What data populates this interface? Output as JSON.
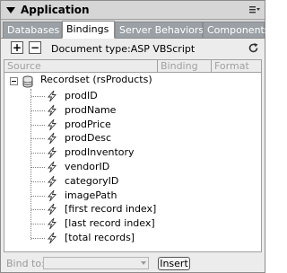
{
  "panel": {
    "title": "Application",
    "options_icon": "options-menu-icon"
  },
  "tabs": [
    {
      "label": "Databases",
      "active": false
    },
    {
      "label": "Bindings",
      "active": true
    },
    {
      "label": "Server Behaviors",
      "active": false
    },
    {
      "label": "Components",
      "active": false
    }
  ],
  "toolbar": {
    "add_label": "+",
    "remove_label": "−",
    "document_type": "Document type:ASP VBScript",
    "refresh_icon": "refresh-icon"
  },
  "columns": [
    "Source",
    "Binding",
    "Format"
  ],
  "tree": {
    "root_label": "Recordset (rsProducts)",
    "root_icon": "recordset-icon",
    "field_icon": "lightning-bolt-icon",
    "fields": [
      "prodID",
      "prodName",
      "prodPrice",
      "prodDesc",
      "prodInventory",
      "vendorID",
      "categoryID",
      "imagePath",
      "[first record index]",
      "[last record index]",
      "[total records]"
    ]
  },
  "bottom": {
    "bind_to_label": "Bind to:",
    "bind_to_value": "",
    "insert_label": "Insert"
  }
}
